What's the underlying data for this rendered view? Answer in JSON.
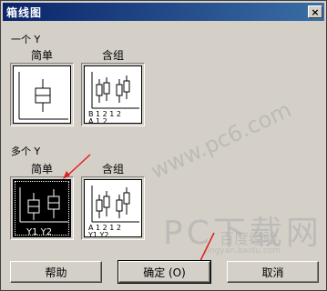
{
  "window": {
    "title": "箱线图",
    "close_glyph": "×"
  },
  "single_y": {
    "group_label": "一个 Y",
    "simple_label": "简单",
    "cluster_label": "含组",
    "cluster_axis": {
      "row1": "B 1 2   1 2",
      "row2": "A   1       2"
    }
  },
  "multi_y": {
    "group_label": "多个 Y",
    "simple_label": "简单",
    "cluster_label": "含组",
    "simple_axis": "Y1  Y2",
    "cluster_axis": {
      "row1": "A 1 2   1 2",
      "row2": "  Y1     Y2"
    }
  },
  "buttons": {
    "help": "帮助",
    "ok": "确定 (O)",
    "cancel": "取消"
  },
  "watermark": {
    "text1": "PC下载网",
    "text2": "www.pc6.com",
    "text3": "jingyan.baidu.com",
    "text4": "百度经验"
  },
  "colors": {
    "title_start": "#0a246a",
    "title_end": "#3a6ea5",
    "face": "#d4d0c8",
    "arrow": "#e02020"
  }
}
